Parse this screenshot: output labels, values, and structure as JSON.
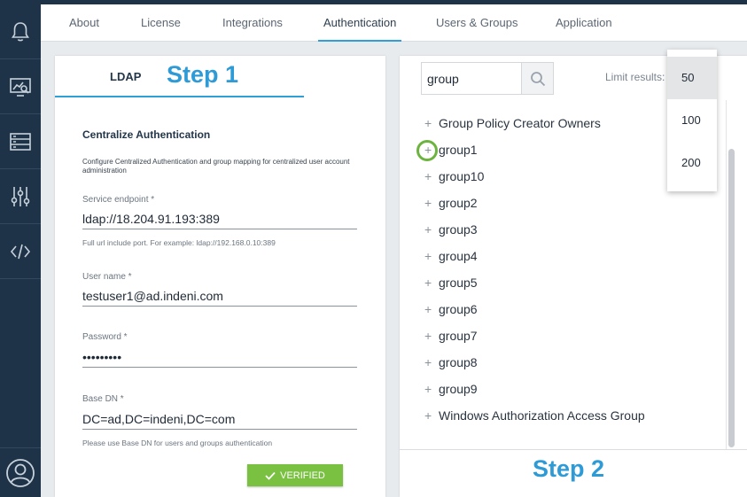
{
  "tabs": [
    "About",
    "License",
    "Integrations",
    "Authentication",
    "Users & Groups",
    "Application"
  ],
  "active_tab": "Authentication",
  "sidebar_icons": [
    "bell-icon",
    "monitor-chart-icon",
    "server-list-icon",
    "sliders-icon",
    "code-icon"
  ],
  "left_panel": {
    "tab_label": "LDAP",
    "step_label": "Step 1",
    "section_title": "Centralize Authentication",
    "section_desc": "Configure Centralized Authentication and group mapping for centralized user account administration",
    "service_endpoint": {
      "label": "Service endpoint *",
      "value": "ldap://18.204.91.193:389",
      "help": "Full url include port. For example: ldap://192.168.0.10:389"
    },
    "user_name": {
      "label": "User name *",
      "value": "testuser1@ad.indeni.com"
    },
    "password": {
      "label": "Password *",
      "value": "•••••••••"
    },
    "base_dn": {
      "label": "Base DN *",
      "value": "DC=ad,DC=indeni,DC=com",
      "help": "Please use Base DN for users and groups authentication"
    },
    "verified_label": "VERIFIED"
  },
  "right_panel": {
    "search_value": "group",
    "limit_label": "Limit results:",
    "groups": [
      "Group Policy Creator Owners",
      "group1",
      "group10",
      "group2",
      "group3",
      "group4",
      "group5",
      "group6",
      "group7",
      "group8",
      "group9",
      "Windows Authorization Access Group"
    ],
    "step_label": "Step 2"
  },
  "limit_dropdown": {
    "options": [
      "50",
      "100",
      "200"
    ],
    "selected": "50"
  },
  "colors": {
    "sidebar": "#1f3348",
    "accent": "#2f9fd8",
    "step_text": "#2e9ad6",
    "verified": "#7ac142",
    "highlight_ring": "#6cb33f"
  }
}
